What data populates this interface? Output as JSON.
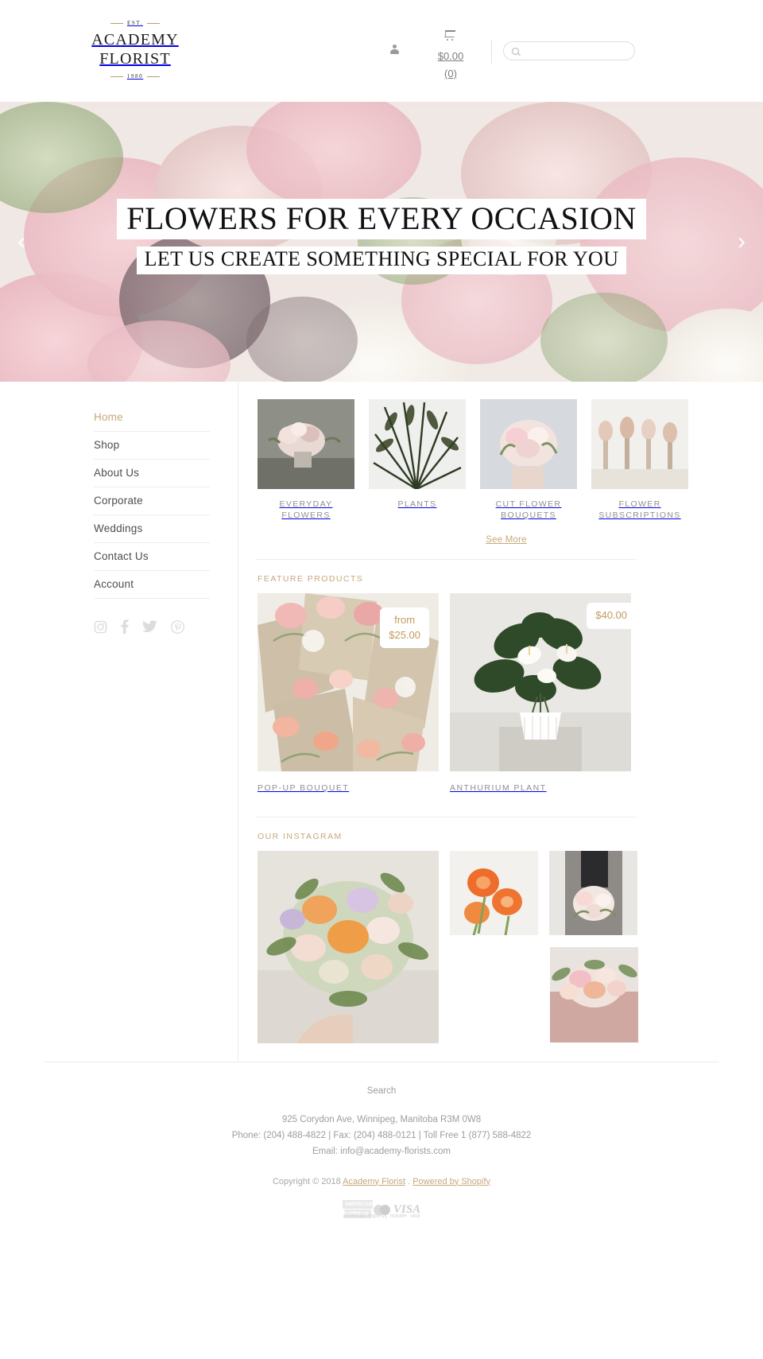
{
  "header": {
    "logo": {
      "est": "EST.",
      "line1": "ACADEMY",
      "line2": "FLORIST",
      "year": "1980"
    },
    "account_icon": "person-icon",
    "cart_icon": "cart-icon",
    "cart_total": "$0.00",
    "cart_count": "(0)",
    "search_icon": "search-icon",
    "search_placeholder": "",
    "search_value": ""
  },
  "hero": {
    "title": "FLOWERS FOR EVERY OCCASION",
    "subtitle": "LET US CREATE SOMETHING SPECIAL FOR YOU",
    "prev_arrow": "‹",
    "next_arrow": "›"
  },
  "sidebar": {
    "items": [
      {
        "label": "Home",
        "active": true
      },
      {
        "label": "Shop",
        "active": false
      },
      {
        "label": "About Us",
        "active": false
      },
      {
        "label": "Corporate",
        "active": false
      },
      {
        "label": "Weddings",
        "active": false
      },
      {
        "label": "Contact Us",
        "active": false
      },
      {
        "label": "Account",
        "active": false
      }
    ],
    "social": [
      {
        "name": "instagram-icon"
      },
      {
        "name": "facebook-icon"
      },
      {
        "name": "twitter-icon"
      },
      {
        "name": "pinterest-icon"
      }
    ]
  },
  "categories": {
    "items": [
      {
        "label": "EVERYDAY FLOWERS"
      },
      {
        "label": "PLANTS"
      },
      {
        "label": "CUT FLOWER BOUQUETS"
      },
      {
        "label": "FLOWER SUBSCRIPTIONS"
      }
    ],
    "see_more": "See More"
  },
  "features": {
    "heading": "FEATURE PRODUCTS",
    "products": [
      {
        "name": "POP-UP BOUQUET",
        "price_prefix": "from",
        "price": "$25.00"
      },
      {
        "name": "ANTHURIUM PLANT",
        "price_prefix": "",
        "price": "$40.00"
      }
    ]
  },
  "instagram": {
    "heading": "OUR INSTAGRAM"
  },
  "footer": {
    "search_link": "Search",
    "address": "925 Corydon Ave, Winnipeg, Manitoba R3M 0W8",
    "phones": "Phone: (204) 488-4822 | Fax: (204) 488-0121 | Toll Free 1 (877) 588-4822",
    "email": "Email: info@academy-florists.com",
    "copyright_prefix": "Copyright © 2018",
    "brand_link": "Academy Florist",
    "copyright_mid": ".",
    "powered_link": "Powered by Shopify",
    "payments": [
      {
        "name": "american-express-icon",
        "caption": "american express"
      },
      {
        "name": "mastercard-icon",
        "caption": "master"
      },
      {
        "name": "visa-icon",
        "caption": "visa"
      }
    ]
  },
  "colors": {
    "accent_gold": "#c6a87a",
    "text_gray": "#8e8e8e",
    "price_gold": "#c49a5e"
  }
}
